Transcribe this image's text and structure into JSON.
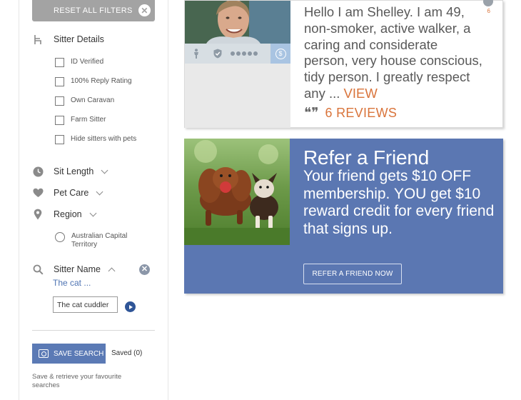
{
  "filters": {
    "reset_label": "RESET ALL FILTERS",
    "sitter_details": {
      "label": "Sitter Details",
      "options": [
        "ID Verified",
        "100% Reply Rating",
        "Own Caravan",
        "Farm Sitter",
        "Hide sitters with pets"
      ]
    },
    "sit_length": {
      "label": "Sit Length"
    },
    "pet_care": {
      "label": "Pet Care"
    },
    "region": {
      "label": "Region",
      "options": [
        "Australian Capital Territory"
      ]
    },
    "sitter_name": {
      "label": "Sitter Name",
      "value_preview": "The cat ...",
      "input_value": "The cat cuddler"
    },
    "save_search": {
      "button_label": "SAVE SEARCH",
      "saved_label": "Saved (0)",
      "help_text": "Save & retrieve your favourite searches"
    }
  },
  "profile_card": {
    "bio": "Hello I am Shelley. I am 49, non-smoker, active walker, a caring and considerate person, very house conscious, tidy person. I greatly respect any ...",
    "view_label": "VIEW",
    "reviews_label": "6 REVIEWS",
    "corner_count": "6",
    "icons": [
      "person-icon",
      "shield-icon",
      "rating-dots-icon",
      "dollar-icon"
    ],
    "rating_dots": 5
  },
  "promo_card": {
    "title": "Refer a Friend",
    "body": "Your friend gets $10 OFF membership. YOU get $10 reward credit for every friend that signs up.",
    "button_label": "REFER A FRIEND NOW",
    "background_color": "#5b77b2"
  },
  "colors": {
    "accent_orange": "#d9743b",
    "link_blue": "#4f74b3",
    "button_blue": "#5b7ab5"
  }
}
